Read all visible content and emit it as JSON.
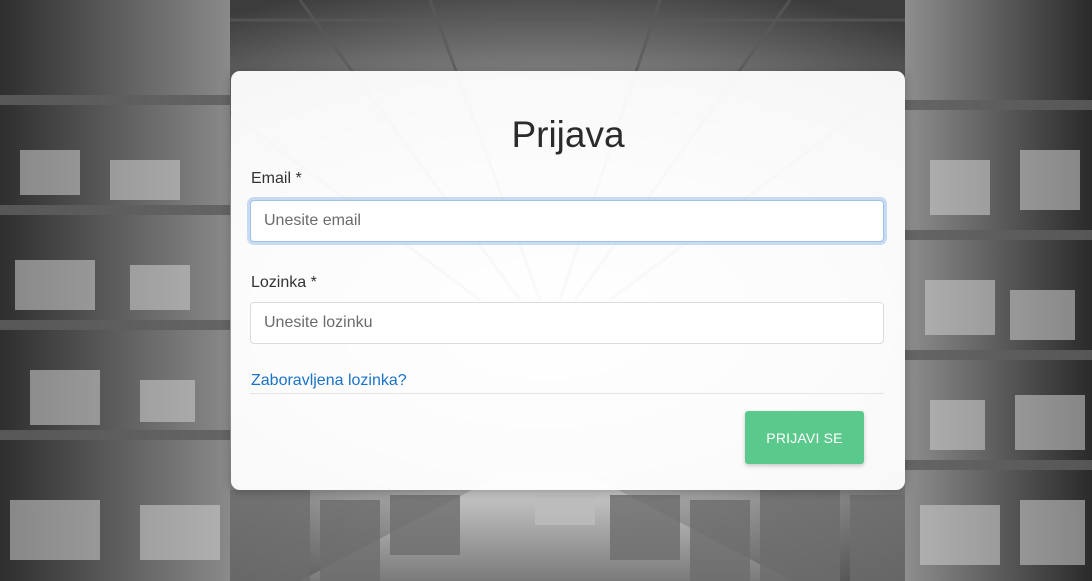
{
  "login": {
    "title": "Prijava",
    "email_label": "Email *",
    "email_placeholder": "Unesite email",
    "email_value": "",
    "password_label": "Lozinka *",
    "password_placeholder": "Unesite lozinku",
    "password_value": "",
    "forgot_password_link": "Zaboravljena lozinka?",
    "submit_label": "PRIJAVI SE"
  },
  "colors": {
    "submit_button": "#5cc98c",
    "link": "#1a73c9",
    "focus_ring": "#9ec3ea"
  }
}
